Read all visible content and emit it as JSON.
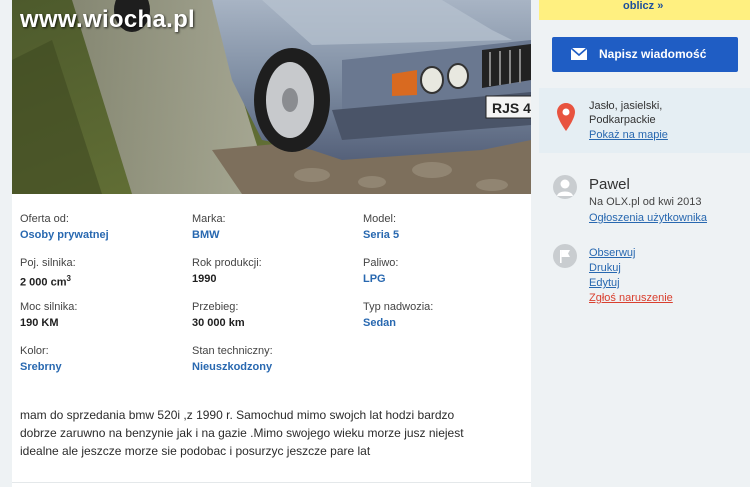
{
  "watermark": "www.wiocha.pl",
  "photo": {
    "description_icon": "car-photo",
    "plate_text": "RJS 4"
  },
  "params": [
    {
      "label": "Oferta od:",
      "value": "Osoby prywatnej",
      "link": true
    },
    {
      "label": "Marka:",
      "value": "BMW",
      "link": true
    },
    {
      "label": "Model:",
      "value": "Seria 5",
      "link": true
    },
    {
      "label": "Poj. silnika:",
      "value": "2 000 cm",
      "unit_sup": "3",
      "link": false
    },
    {
      "label": "Rok produkcji:",
      "value": "1990",
      "link": false
    },
    {
      "label": "Paliwo:",
      "value": "LPG",
      "link": true
    },
    {
      "label": "Moc silnika:",
      "value": "190 KM",
      "link": false
    },
    {
      "label": "Przebieg:",
      "value": "30 000 km",
      "link": false
    },
    {
      "label": "Typ nadwozia:",
      "value": "Sedan",
      "link": true
    },
    {
      "label": "Kolor:",
      "value": "Srebrny",
      "link": true
    },
    {
      "label": "Stan techniczny:",
      "value": "Nieuszkodzony",
      "link": true
    }
  ],
  "description": {
    "lines": [
      "mam do sprzedania bmw 520i ,z 1990 r. Samochud mimo swojch lat hodzi bardzo",
      "dobrze zaruwno na benzynie jak i na gazie .Mimo swojego wieku morze jusz niejest",
      "idealne ale jeszcze morze sie podobac i posurzyc jeszcze pare lat"
    ]
  },
  "sidebar": {
    "price_link": "oblicz »",
    "message_button": "Napisz wiadomość",
    "location": {
      "line1": "Jasło, jasielski,",
      "line2": "Podkarpackie",
      "map_link": "Pokaż na mapie"
    },
    "user": {
      "name": "Pawel",
      "since": "Na OLX.pl od kwi 2013",
      "ads_link": "Ogłoszenia użytkownika"
    },
    "actions": {
      "observe": "Obserwuj",
      "print": "Drukuj",
      "edit": "Edytuj",
      "report": "Zgłoś naruszenie"
    }
  },
  "colors": {
    "link": "#2868b0",
    "button": "#1f5dc4",
    "report": "#d9402f",
    "price_bg": "#fff080",
    "location_bg": "#e5eef3"
  }
}
